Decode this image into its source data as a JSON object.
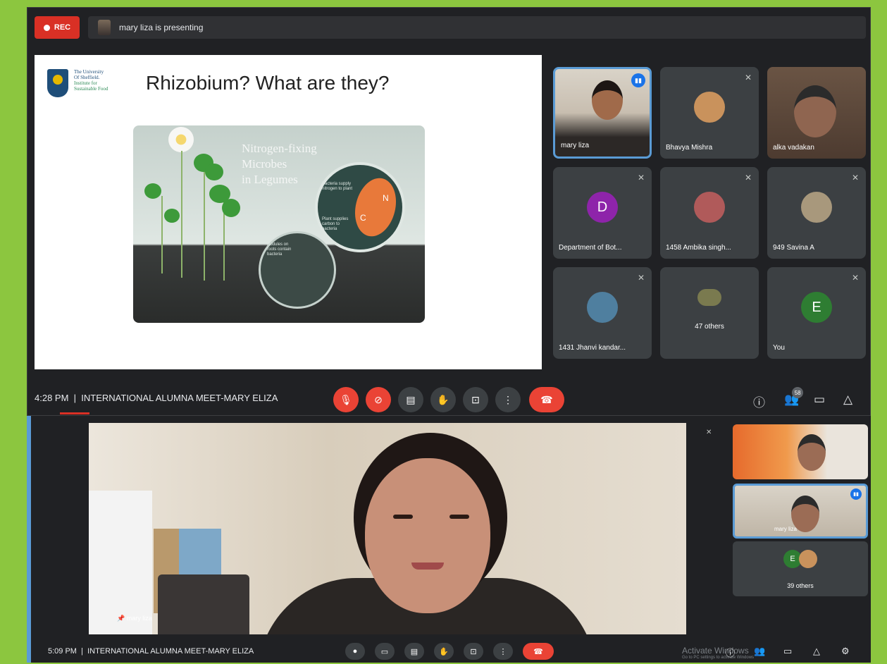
{
  "top_meet": {
    "rec_label": "REC",
    "presenting_text": "mary liza is presenting",
    "slide": {
      "title": "Rhizobium? What are they?",
      "uni_line1": "The University",
      "uni_line2": "Of Sheffield.",
      "uni_line3": "Institute for",
      "uni_line4": "Sustainable Food",
      "illustration_title_1": "Nitrogen-fixing",
      "illustration_title_2": "Microbes",
      "illustration_title_3": "in Legumes",
      "nodule_text": "Nodules on roots contain bacteria",
      "bacteria_text": "Bacteria supply nitrogen to plant",
      "plant_text": "Plant supplies carbon to bacteria",
      "n_label": "N",
      "c_label": "C"
    },
    "participants": [
      {
        "name": "mary liza",
        "initial": "",
        "avatar_color": "",
        "muted": false
      },
      {
        "name": "Bhavya Mishra",
        "initial": "",
        "avatar_color": "#c9925c",
        "muted": true
      },
      {
        "name": "alka vadakan",
        "initial": "",
        "avatar_color": "",
        "muted": false
      },
      {
        "name": "Department of Bot...",
        "initial": "D",
        "avatar_color": "#8e24aa",
        "muted": true
      },
      {
        "name": "1458 Ambika singh...",
        "initial": "",
        "avatar_color": "#b05a5a",
        "muted": true
      },
      {
        "name": "949 Savina A",
        "initial": "",
        "avatar_color": "#a8987c",
        "muted": true
      },
      {
        "name": "1431 Jhanvi kandar...",
        "initial": "",
        "avatar_color": "#4f7f9f",
        "muted": true
      },
      {
        "name": "47 others",
        "initial": "",
        "avatar_color": "#7a7a4f",
        "muted": false
      },
      {
        "name": "You",
        "initial": "E",
        "avatar_color": "#2e7d32",
        "muted": true
      }
    ],
    "time": "4:28 PM",
    "meeting_title": "INTERNATIONAL ALUMNA MEET-MARY ELIZA",
    "people_count": "58"
  },
  "bottom_meet": {
    "pinned_name": "mary liza",
    "tile2_name": "mary liza",
    "others_label": "39 others",
    "you_initial": "E",
    "time": "5:09 PM",
    "meeting_title": "INTERNATIONAL ALUMNA MEET-MARY ELIZA",
    "activate_line1": "Activate Windows",
    "activate_line2": "Go to PC settings to activate Windows"
  },
  "colors": {
    "frame": "#8cc63f",
    "meet_bg": "#202124",
    "tile_bg": "#3c4043",
    "danger": "#ea4335",
    "accent": "#1a73e8"
  },
  "icons": [
    "record-dot-icon",
    "mic-off-icon",
    "camera-off-icon",
    "captions-icon",
    "raise-hand-icon",
    "present-icon",
    "more-options-icon",
    "end-call-icon",
    "info-icon",
    "people-icon",
    "chat-icon",
    "activities-icon",
    "pin-icon"
  ]
}
